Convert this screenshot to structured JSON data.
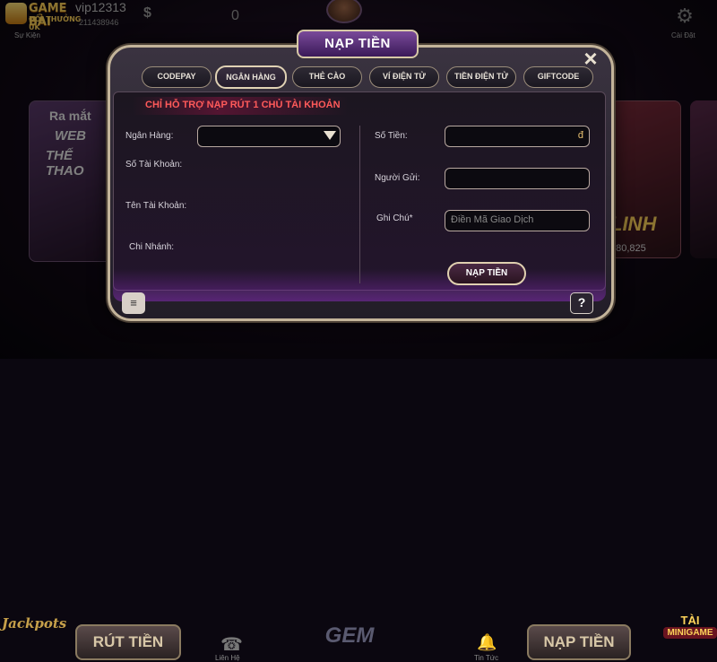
{
  "header": {
    "logo_title": "GAME BÀI",
    "logo_subtitle": "ĐỔI THƯỞNG UK",
    "user_name": "vip12313",
    "user_id": "211438946",
    "event_label": "Sự Kiện",
    "balance": "0",
    "settings_label": "Cài Đặt",
    "coin_icon": "$"
  },
  "lobby": {
    "left_card": [
      "Ra mắt",
      "WEB",
      "THẾ THAO"
    ],
    "right_card_name": "LINH",
    "right_card_amount": "580,825",
    "jackpot_label": "Jackpots",
    "withdraw_label": "RÚT TIỀN",
    "contact_label": "Liên Hệ",
    "news_label": "Tin Tức",
    "deposit_label": "NẠP TIỀN",
    "minigame_tai": "TÀI",
    "minigame_label": "MINIGAME"
  },
  "dialog": {
    "title": "NẠP TIỀN",
    "close_icon": "×",
    "tabs": [
      "CODEPAY",
      "NGÂN HÀNG",
      "THẺ CÀO",
      "VÍ ĐIỆN TỬ",
      "TIỀN ĐIỆN TỬ",
      "GIFTCODE"
    ],
    "active_tab": "NGÂN HÀNG",
    "notice": "CHỈ HỖ TRỢ NẠP RÚT 1 CHỦ TÀI KHOẢN",
    "left": {
      "bank_label": "Ngân Hàng:",
      "bank_value": "",
      "account_number_label": "Số Tài Khoản:",
      "account_name_label": "Tên Tài Khoản:",
      "branch_label": "Chi Nhánh:"
    },
    "right": {
      "amount_label": "Số Tiền:",
      "amount_currency": "đ",
      "sender_label": "Người Gửi:",
      "note_label": "Ghi Chú*",
      "note_placeholder": "Điền Mã Giao Dịch"
    },
    "submit_label": "NẠP TIỀN",
    "history_icon": "≡",
    "help_icon": "?"
  }
}
